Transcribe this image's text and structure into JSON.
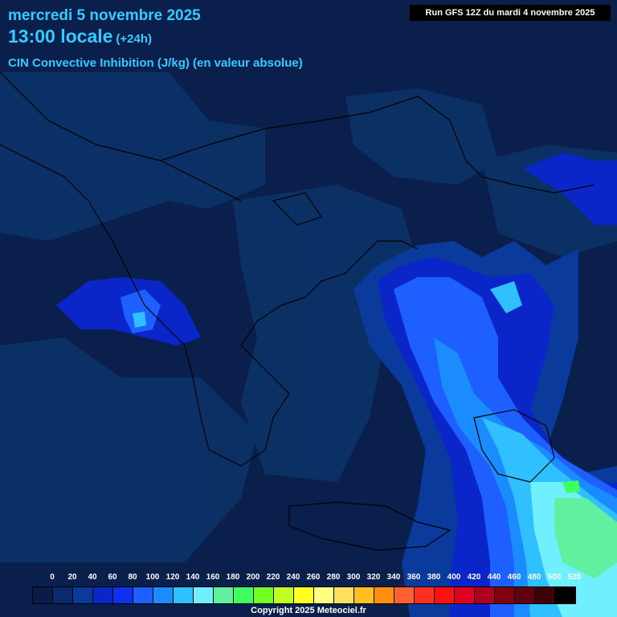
{
  "header": {
    "date": "mercredi 5 novembre 2025",
    "time": "13:00 locale",
    "offset": "(+24h)",
    "parameter": "CIN Convective Inhibition (J/kg) (en valeur absolue)",
    "run": "Run GFS 12Z du mardi 4 novembre 2025"
  },
  "legend": {
    "ticks": [
      "0",
      "20",
      "40",
      "60",
      "80",
      "100",
      "120",
      "140",
      "160",
      "180",
      "200",
      "220",
      "240",
      "260",
      "280",
      "300",
      "320",
      "340",
      "360",
      "380",
      "400",
      "420",
      "440",
      "460",
      "480",
      "500",
      "520"
    ],
    "colors": [
      "#0a1a4a",
      "#0b2a6b",
      "#0a3a9c",
      "#0a25c8",
      "#1030f0",
      "#1e60ff",
      "#1a8cff",
      "#30c0ff",
      "#70f0ff",
      "#60f0a0",
      "#40ff60",
      "#70ff20",
      "#c0ff20",
      "#ffff20",
      "#ffff80",
      "#ffe060",
      "#ffc020",
      "#ff9010",
      "#ff6030",
      "#ff3020",
      "#ff1010",
      "#e00020",
      "#b00020",
      "#800010",
      "#600010",
      "#400008",
      "#000000"
    ]
  },
  "footer": {
    "copyright": "Copyright 2025 Meteociel.fr"
  }
}
